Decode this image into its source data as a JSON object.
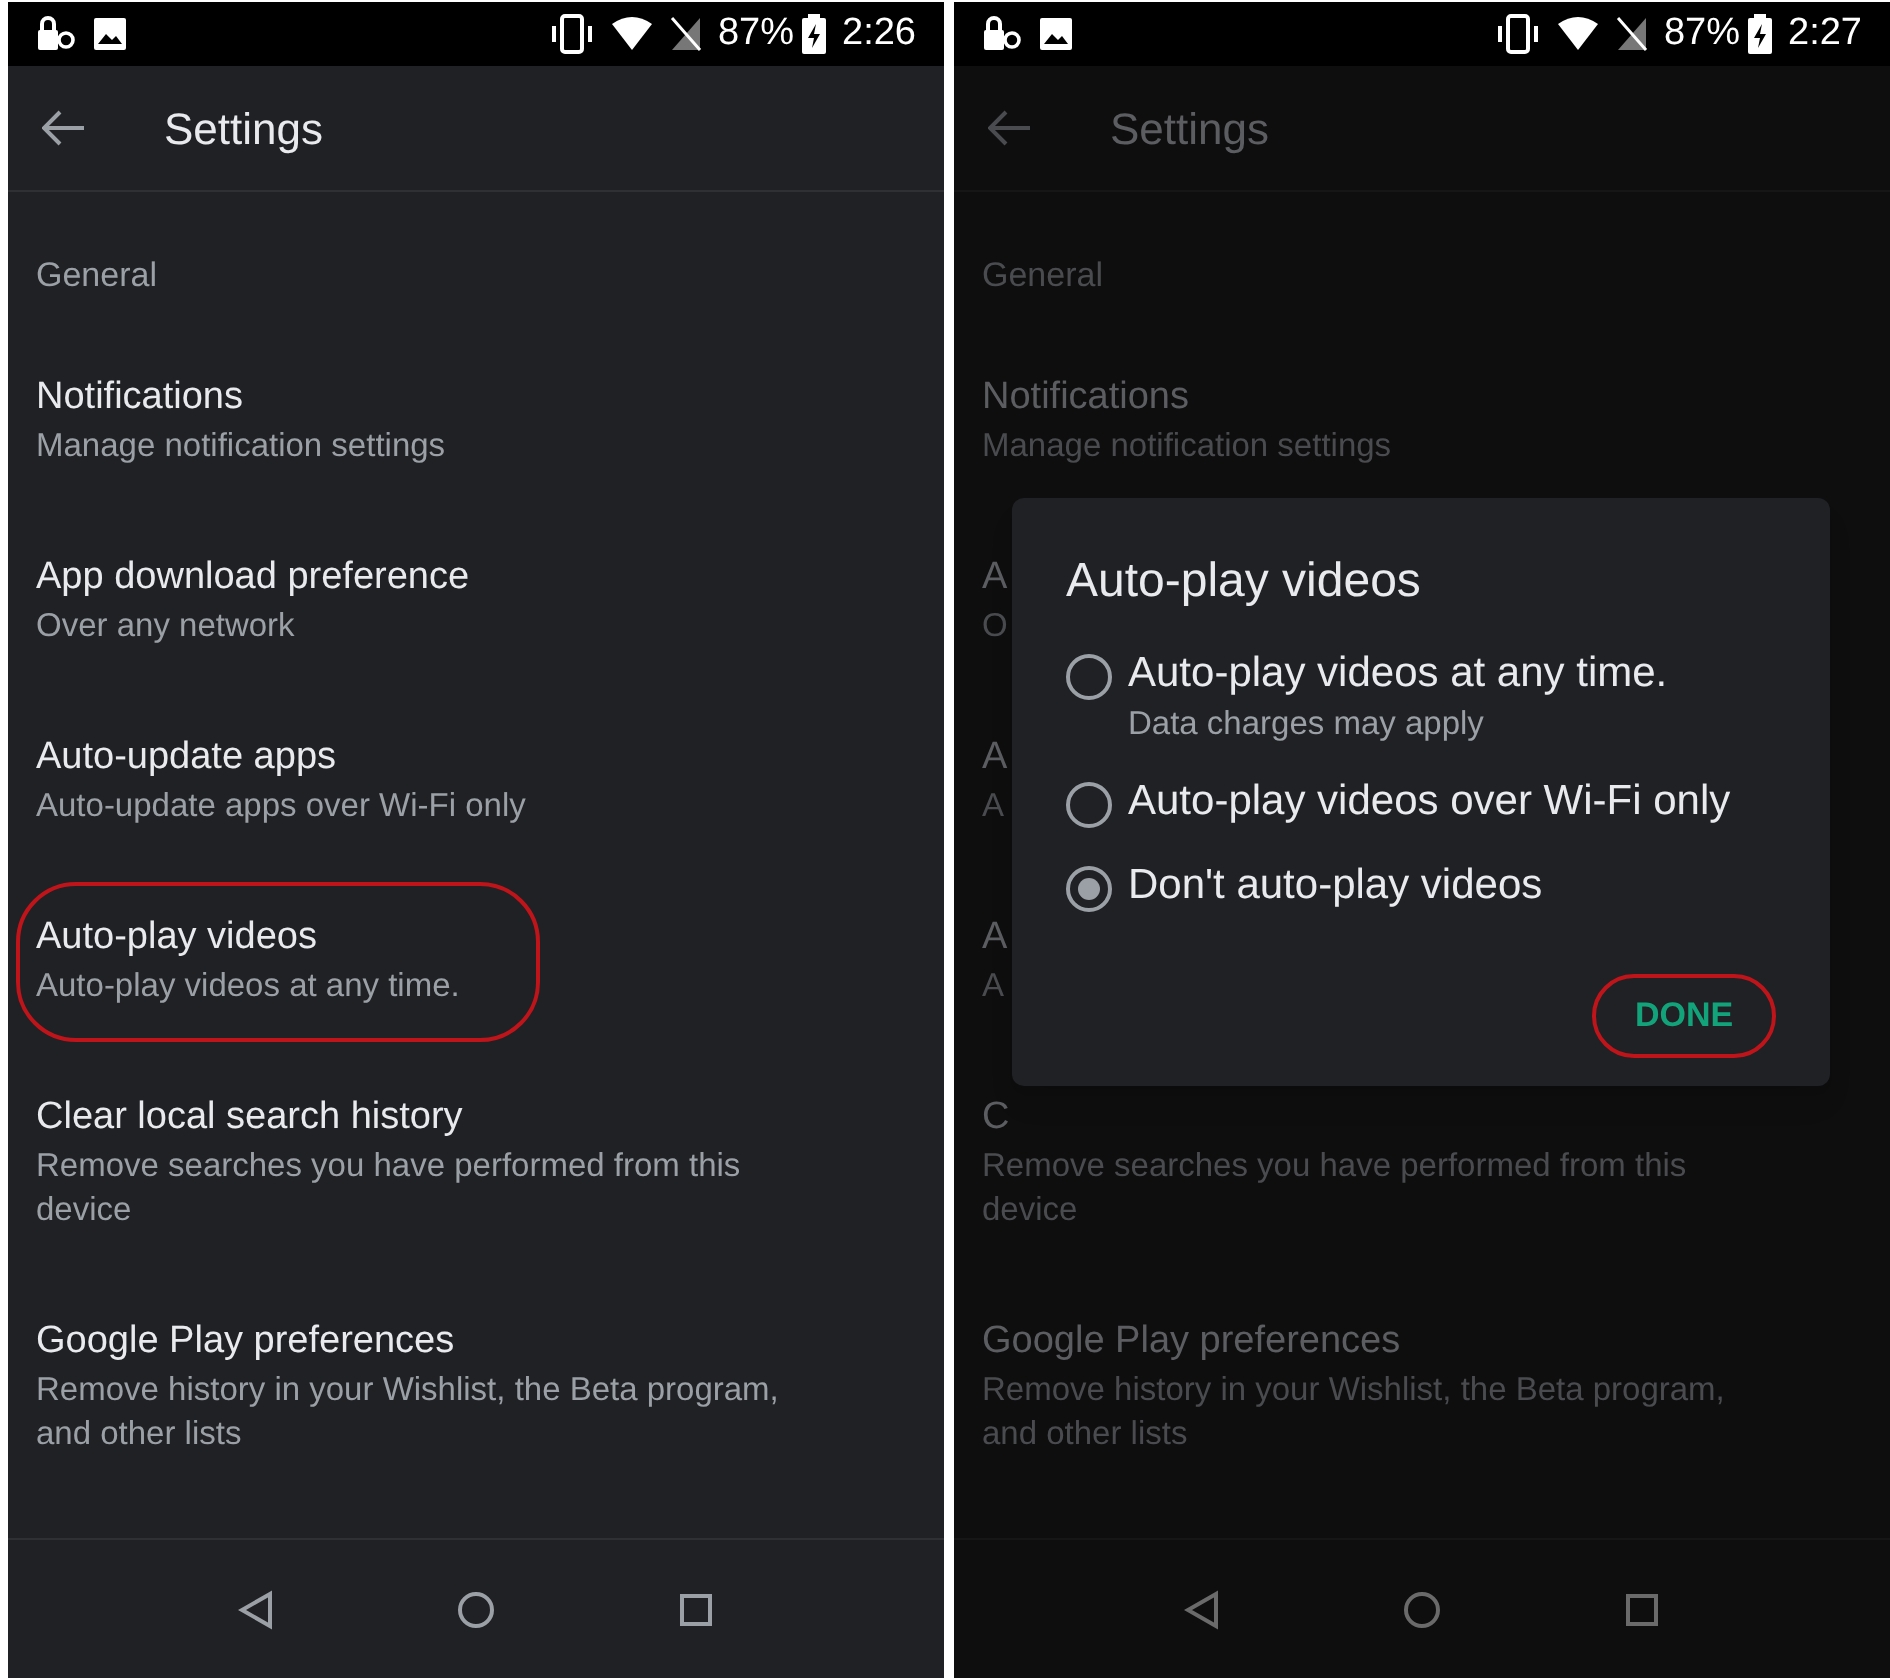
{
  "screens": [
    {
      "dimmed": false,
      "status_bar": {
        "battery": "87%",
        "time": "2:26"
      },
      "title": "Settings",
      "section": "General",
      "items": [
        {
          "title": "Notifications",
          "subtitle": "Manage notification settings",
          "circled": false
        },
        {
          "title": "App download preference",
          "subtitle": "Over any network",
          "circled": false
        },
        {
          "title": "Auto-update apps",
          "subtitle": "Auto-update apps over Wi-Fi only",
          "circled": false
        },
        {
          "title": "Auto-play videos",
          "subtitle": "Auto-play videos at any time.",
          "circled": true
        },
        {
          "title": "Clear local search history",
          "subtitle": "Remove searches you have performed from this device",
          "circled": false
        },
        {
          "title": "Google Play preferences",
          "subtitle": "Remove history in your Wishlist, the Beta program, and other lists",
          "circled": false
        }
      ]
    },
    {
      "dimmed": true,
      "status_bar": {
        "battery": "87%",
        "time": "2:27"
      },
      "title": "Settings",
      "section": "General",
      "items": [
        {
          "title": "Notifications",
          "subtitle": "Manage notification settings",
          "circled": false
        },
        {
          "title": "A",
          "subtitle": "O",
          "circled": false
        },
        {
          "title": "A",
          "subtitle": "A",
          "circled": false
        },
        {
          "title": "A",
          "subtitle": "A",
          "circled": false
        },
        {
          "title": "C",
          "subtitle": "Remove searches you have performed from this device",
          "circled": false
        },
        {
          "title": "Google Play preferences",
          "subtitle": "Remove history in your Wishlist, the Beta program, and other lists",
          "circled": false
        }
      ],
      "dialog": {
        "title": "Auto-play videos",
        "options": [
          {
            "label": "Auto-play videos at any time.",
            "detail": "Data charges may apply",
            "selected": false
          },
          {
            "label": "Auto-play videos over Wi-Fi only",
            "selected": false
          },
          {
            "label": "Don't auto-play videos",
            "selected": true
          }
        ],
        "button": {
          "label": "DONE",
          "circled": true
        }
      }
    }
  ]
}
